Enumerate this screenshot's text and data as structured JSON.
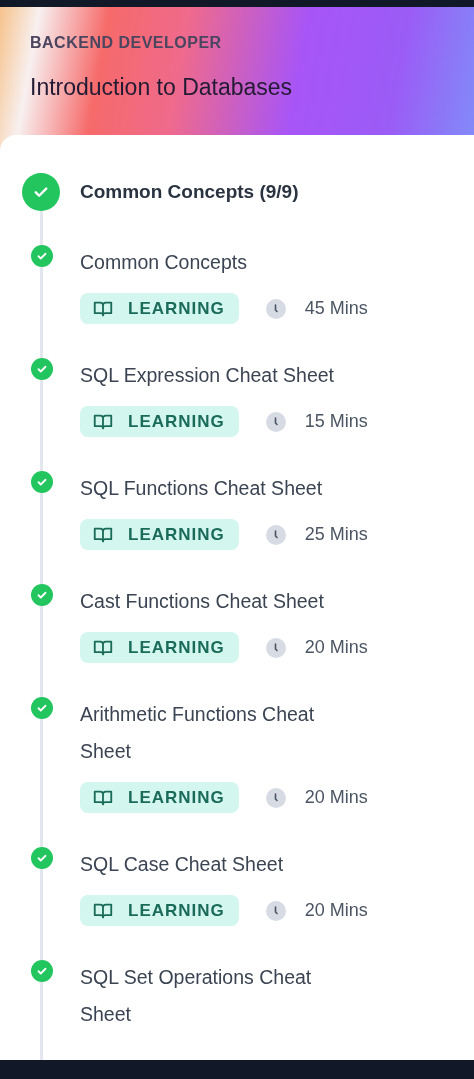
{
  "header": {
    "track": "BACKEND DEVELOPER",
    "title": "Introduction to Databases"
  },
  "section": {
    "title": "Common Concepts (9/9)",
    "completed": true
  },
  "lessons": [
    {
      "title": "Common Concepts",
      "completed": true,
      "badge": "LEARNING",
      "duration": "45 Mins"
    },
    {
      "title": "SQL Expression Cheat Sheet",
      "completed": true,
      "badge": "LEARNING",
      "duration": "15 Mins"
    },
    {
      "title": "SQL Functions Cheat Sheet",
      "completed": true,
      "badge": "LEARNING",
      "duration": "25 Mins"
    },
    {
      "title": "Cast Functions Cheat Sheet",
      "completed": true,
      "badge": "LEARNING",
      "duration": "20 Mins"
    },
    {
      "title": "Arithmetic Functions Cheat Sheet",
      "completed": true,
      "badge": "LEARNING",
      "duration": "20 Mins"
    },
    {
      "title": "SQL Case Cheat Sheet",
      "completed": true,
      "badge": "LEARNING",
      "duration": "20 Mins"
    },
    {
      "title": "SQL Set Operations Cheat Sheet",
      "completed": true
    }
  ]
}
